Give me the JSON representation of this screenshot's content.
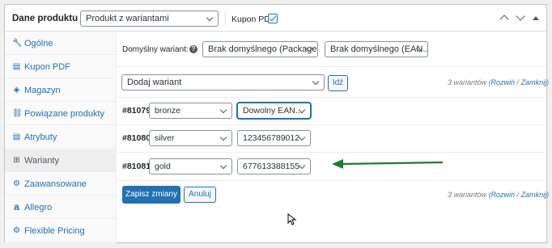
{
  "header": {
    "title": "Dane produktu —",
    "product_type": "Produkt z wariantami",
    "coupon_label": "Kupon PDF:"
  },
  "sidebar": {
    "items": [
      {
        "label": "Ogólne",
        "icon": "wrench-icon",
        "glyph": "🔧"
      },
      {
        "label": "Kupon PDF",
        "icon": "document-icon",
        "glyph": "▤"
      },
      {
        "label": "Magazyn",
        "icon": "tag-icon",
        "glyph": "◈"
      },
      {
        "label": "Powiązane produkty",
        "icon": "link-icon",
        "glyph": "⛓"
      },
      {
        "label": "Atrybuty",
        "icon": "list-icon",
        "glyph": "▤"
      },
      {
        "label": "Warianty",
        "icon": "grid-icon",
        "glyph": "⊞"
      },
      {
        "label": "Zaawansowane",
        "icon": "gear-icon",
        "glyph": "⚙"
      },
      {
        "label": "Allegro",
        "icon": "allegro-icon",
        "glyph": "a"
      },
      {
        "label": "Flexible Pricing",
        "icon": "gear-icon",
        "glyph": "⚙"
      }
    ]
  },
  "main": {
    "default_label": "Domyślny wariant:",
    "default_select_1": "Brak domyślnego (Package...)",
    "default_select_2": "Brak domyślnego (EAN...)",
    "add_variant": "Dodaj wariant",
    "go_button": "Idź",
    "count_text": "3 wariantów (",
    "expand": "Rozwiń",
    "slash": " / ",
    "collapse": "Zamknij",
    "close_paren": ")",
    "variants": [
      {
        "id": "#81079",
        "color": "bronze",
        "ean": "Dowolny EAN..."
      },
      {
        "id": "#81080",
        "color": "silver",
        "ean": "123456789012"
      },
      {
        "id": "#81081",
        "color": "gold",
        "ean": "677613388155"
      }
    ],
    "save_button": "Zapisz zmiany",
    "cancel_button": "Anuluj"
  },
  "colors": {
    "accent": "#2271b1",
    "arrow": "#1f7a34"
  }
}
